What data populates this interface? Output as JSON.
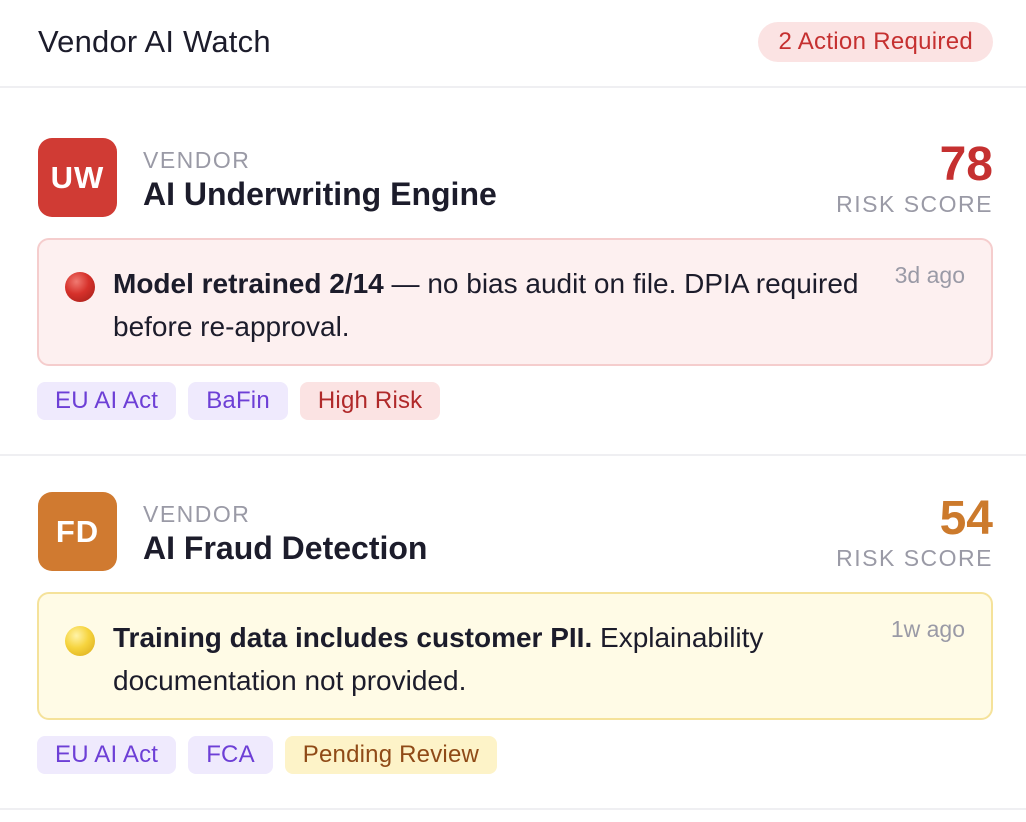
{
  "header": {
    "title": "Vendor AI Watch",
    "badge": "2 Action Required"
  },
  "vendors": [
    {
      "initials": "UW",
      "label": "VENDOR",
      "name": "AI Underwriting Engine",
      "risk_score": "78",
      "risk_label": "RISK SCORE",
      "alert": {
        "severity": "red",
        "bold": "Model retrained 2/14",
        "text": " — no bias audit on file. DPIA required before re-approval.",
        "time": "3d ago"
      },
      "tags": [
        "EU AI Act",
        "BaFin",
        "High Risk"
      ],
      "color": "#d03b34"
    },
    {
      "initials": "FD",
      "label": "VENDOR",
      "name": "AI Fraud Detection",
      "risk_score": "54",
      "risk_label": "RISK SCORE",
      "alert": {
        "severity": "yellow",
        "bold": "Training data includes customer PII.",
        "text": " Explainability documentation not provided.",
        "time": "1w ago"
      },
      "tags": [
        "EU AI Act",
        "FCA",
        "Pending Review"
      ],
      "color": "#d07a30"
    }
  ]
}
